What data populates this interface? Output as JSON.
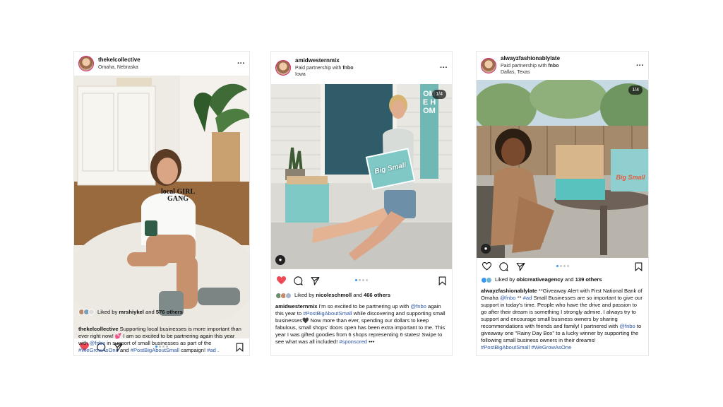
{
  "colors": {
    "heart": "#ed4956",
    "hashtag": "#2a55a5",
    "dot_active": "#3897f0"
  },
  "posts": [
    {
      "username": "thekelcollective",
      "sub1": "Omaha, Nebraska",
      "sub2": "",
      "counter": "",
      "liked": true,
      "liked_prefix": "Liked by",
      "liked_user": "mrshiykel",
      "liked_and": "and",
      "liked_count": "576 others",
      "caption_user": "thekelcollective",
      "caption_p1": " Supporting local businesses is more important than ever right now! 💕 I am so excited to be partnering again this year with ",
      "caption_mention": "@fnbo",
      "caption_p2": " in support of small businesses as part of the ",
      "caption_tag1": "#WeGrowAsOne",
      "caption_p3": " and ",
      "caption_tag2": "#PostBigAboutSmall",
      "caption_p4": " campaign! ",
      "caption_tag3": "#ad",
      "caption_end": " .",
      "shirt_text": "local GIRL GANG"
    },
    {
      "username": "amidwesternmix",
      "sub1": "Paid partnership with ",
      "sub1_bold": "fnbo",
      "sub2": "Iowa",
      "counter": "1/4",
      "liked": true,
      "liked_prefix": "Liked by",
      "liked_user": "nicoleschmoll",
      "liked_and": "and",
      "liked_count": "466 others",
      "caption_user": "amidwesternmix",
      "caption_p1": " I'm so excited to be partnering up with ",
      "caption_mention": "@fnbo",
      "caption_p2": " again this year to ",
      "caption_tag1": "#PostBigAboutSmall",
      "caption_p3": " while discovering and supporting small businesses🖤 Now more than ever, spending our dollars to keep fabulous, small shops' doors open has been extra important to me. This year I was gifted goodies from 6 shops representing 6 states! Swipe to see what was all included! ",
      "caption_tag2": "#sponsored",
      "caption_end": " •••",
      "box_text": "Big Small",
      "sign_text": "OME HOM"
    },
    {
      "username": "alwayzfashionablylate",
      "sub1": "Paid partnership with ",
      "sub1_bold": "fnbo",
      "sub2": "Dallas, Texas",
      "counter": "1/4",
      "liked": false,
      "liked_prefix": "Liked by",
      "liked_user": "obicreativeagency",
      "liked_and": "and",
      "liked_count": "139 others",
      "caption_user": "alwayzfashionablylate",
      "caption_p1": " **Giveaway Alert with First National Bank of Omaha ",
      "caption_mention": "@fnbo",
      "caption_p2": " ** ",
      "caption_tag1": "#ad",
      "caption_p3": " Small Businesses are so important to give our support in today's time. People who have the drive and passion to go after their dream is something I strongly admire. I always try to support and encourage small business owners by sharing recommendations with friends and family! I partnered with ",
      "caption_mention2": "@fnbo",
      "caption_p4": " to giveaway one \"Rainy Day Box\" to a lucky winner by supporting the following small business owners in their dreams! ",
      "caption_tag2": "#PostBigAboutSmall",
      "caption_p5": " ",
      "caption_tag3": "#WeGrowAsOne",
      "box_text": "Big Small"
    }
  ]
}
